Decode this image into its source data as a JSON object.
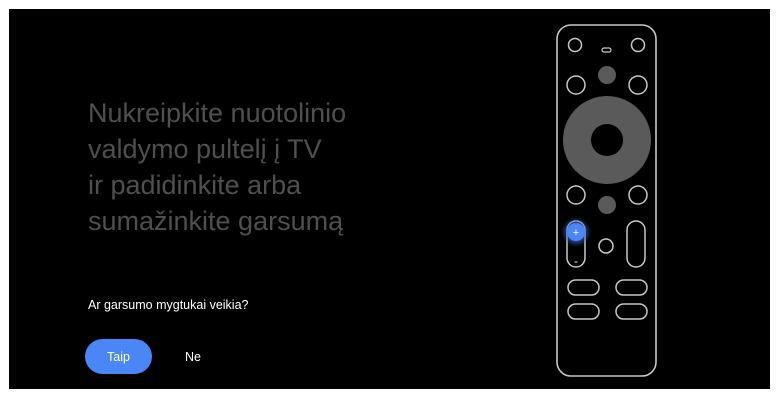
{
  "screen": {
    "title": "Nukreipkite nuotolinio\nvaldymo pultelį į TV\nir padidinkite arba\nsumažinkite garsumą",
    "question": "Ar garsumo mygtukai veikia?",
    "yes_label": "Taip",
    "no_label": "Ne"
  },
  "remote": {
    "volume_up_label": "+",
    "volume_down_label": "-",
    "highlighted_button": "volume-up"
  },
  "colors": {
    "background": "#000000",
    "title_text": "#4f4f4f",
    "accent": "#4a86f5",
    "remote_outline": "#c8c8c8",
    "remote_fill": "#5a5a5a"
  }
}
